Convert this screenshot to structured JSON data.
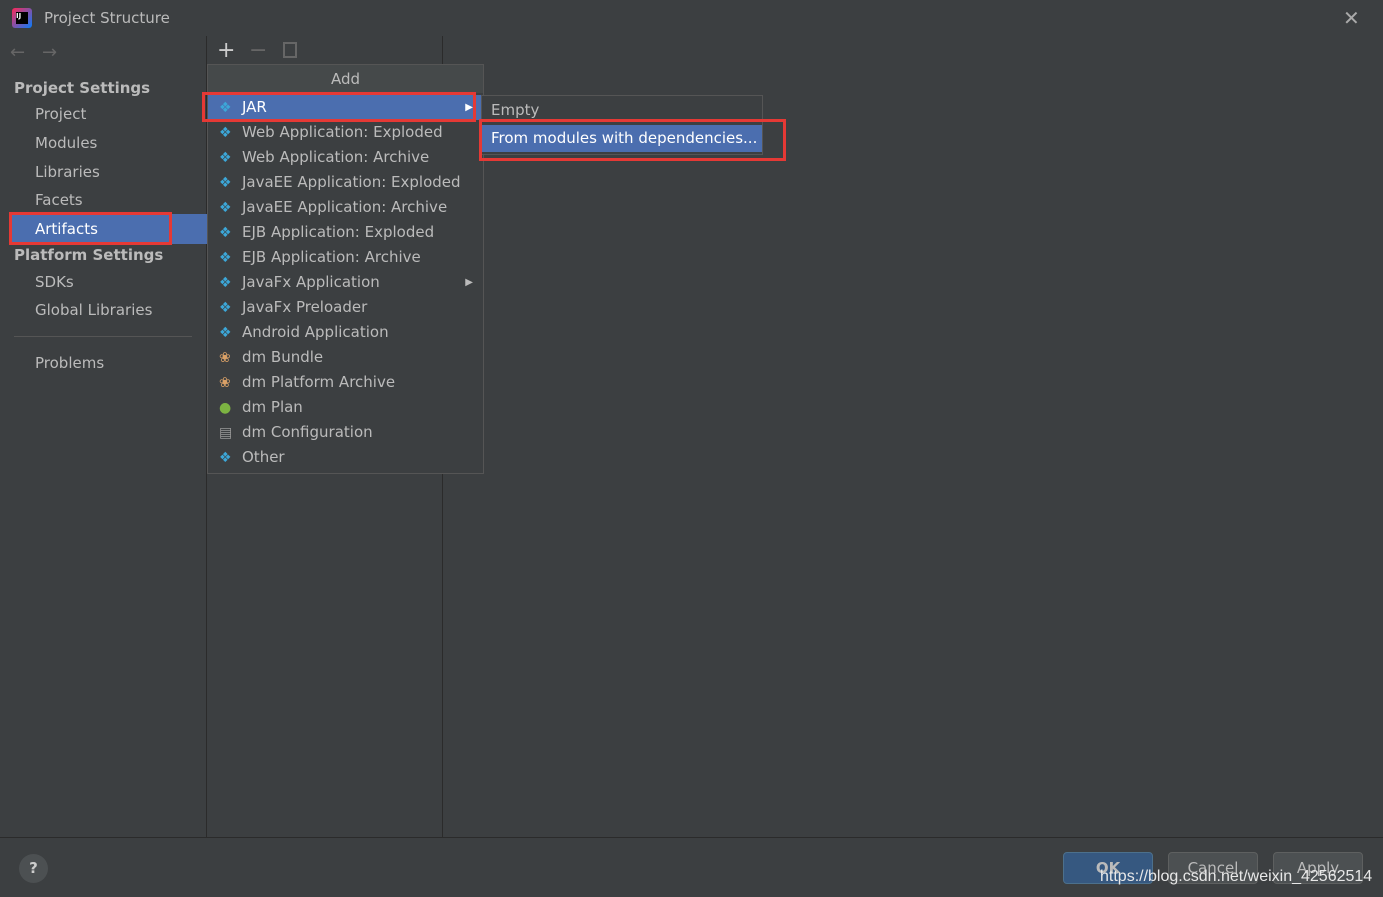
{
  "window": {
    "title": "Project Structure"
  },
  "sidebar": {
    "project_settings": "Project Settings",
    "items": [
      "Project",
      "Modules",
      "Libraries",
      "Facets",
      "Artifacts"
    ],
    "platform_settings": "Platform Settings",
    "platform_items": [
      "SDKs",
      "Global Libraries"
    ],
    "problems": "Problems",
    "selected": "Artifacts"
  },
  "menu": {
    "title": "Add",
    "items": [
      {
        "label": "JAR",
        "icon": "jar-icon"
      },
      {
        "label": "Web Application: Exploded",
        "icon": "web-app-icon"
      },
      {
        "label": "Web Application: Archive",
        "icon": "web-app-icon"
      },
      {
        "label": "JavaEE Application: Exploded",
        "icon": "javaee-icon"
      },
      {
        "label": "JavaEE Application: Archive",
        "icon": "javaee-icon"
      },
      {
        "label": "EJB Application: Exploded",
        "icon": "ejb-icon"
      },
      {
        "label": "EJB Application: Archive",
        "icon": "ejb-icon"
      },
      {
        "label": "JavaFx Application",
        "icon": "javafx-icon"
      },
      {
        "label": "JavaFx Preloader",
        "icon": "javafx-icon"
      },
      {
        "label": "Android Application",
        "icon": "android-icon"
      },
      {
        "label": "dm Bundle",
        "icon": "dm-bundle-icon"
      },
      {
        "label": "dm Platform Archive",
        "icon": "dm-archive-icon"
      },
      {
        "label": "dm Plan",
        "icon": "dm-plan-icon"
      },
      {
        "label": "dm Configuration",
        "icon": "dm-config-icon"
      },
      {
        "label": "Other",
        "icon": "artifact-icon"
      }
    ]
  },
  "submenu": {
    "items": [
      "Empty",
      "From modules with dependencies..."
    ]
  },
  "buttons": {
    "ok": "OK",
    "cancel": "Cancel",
    "apply": "Apply",
    "help": "?"
  },
  "watermark": "https://blog.csdn.net/weixin_42562514",
  "colors": {
    "selection": "#4b6eaf",
    "highlight_box": "#e53935"
  }
}
